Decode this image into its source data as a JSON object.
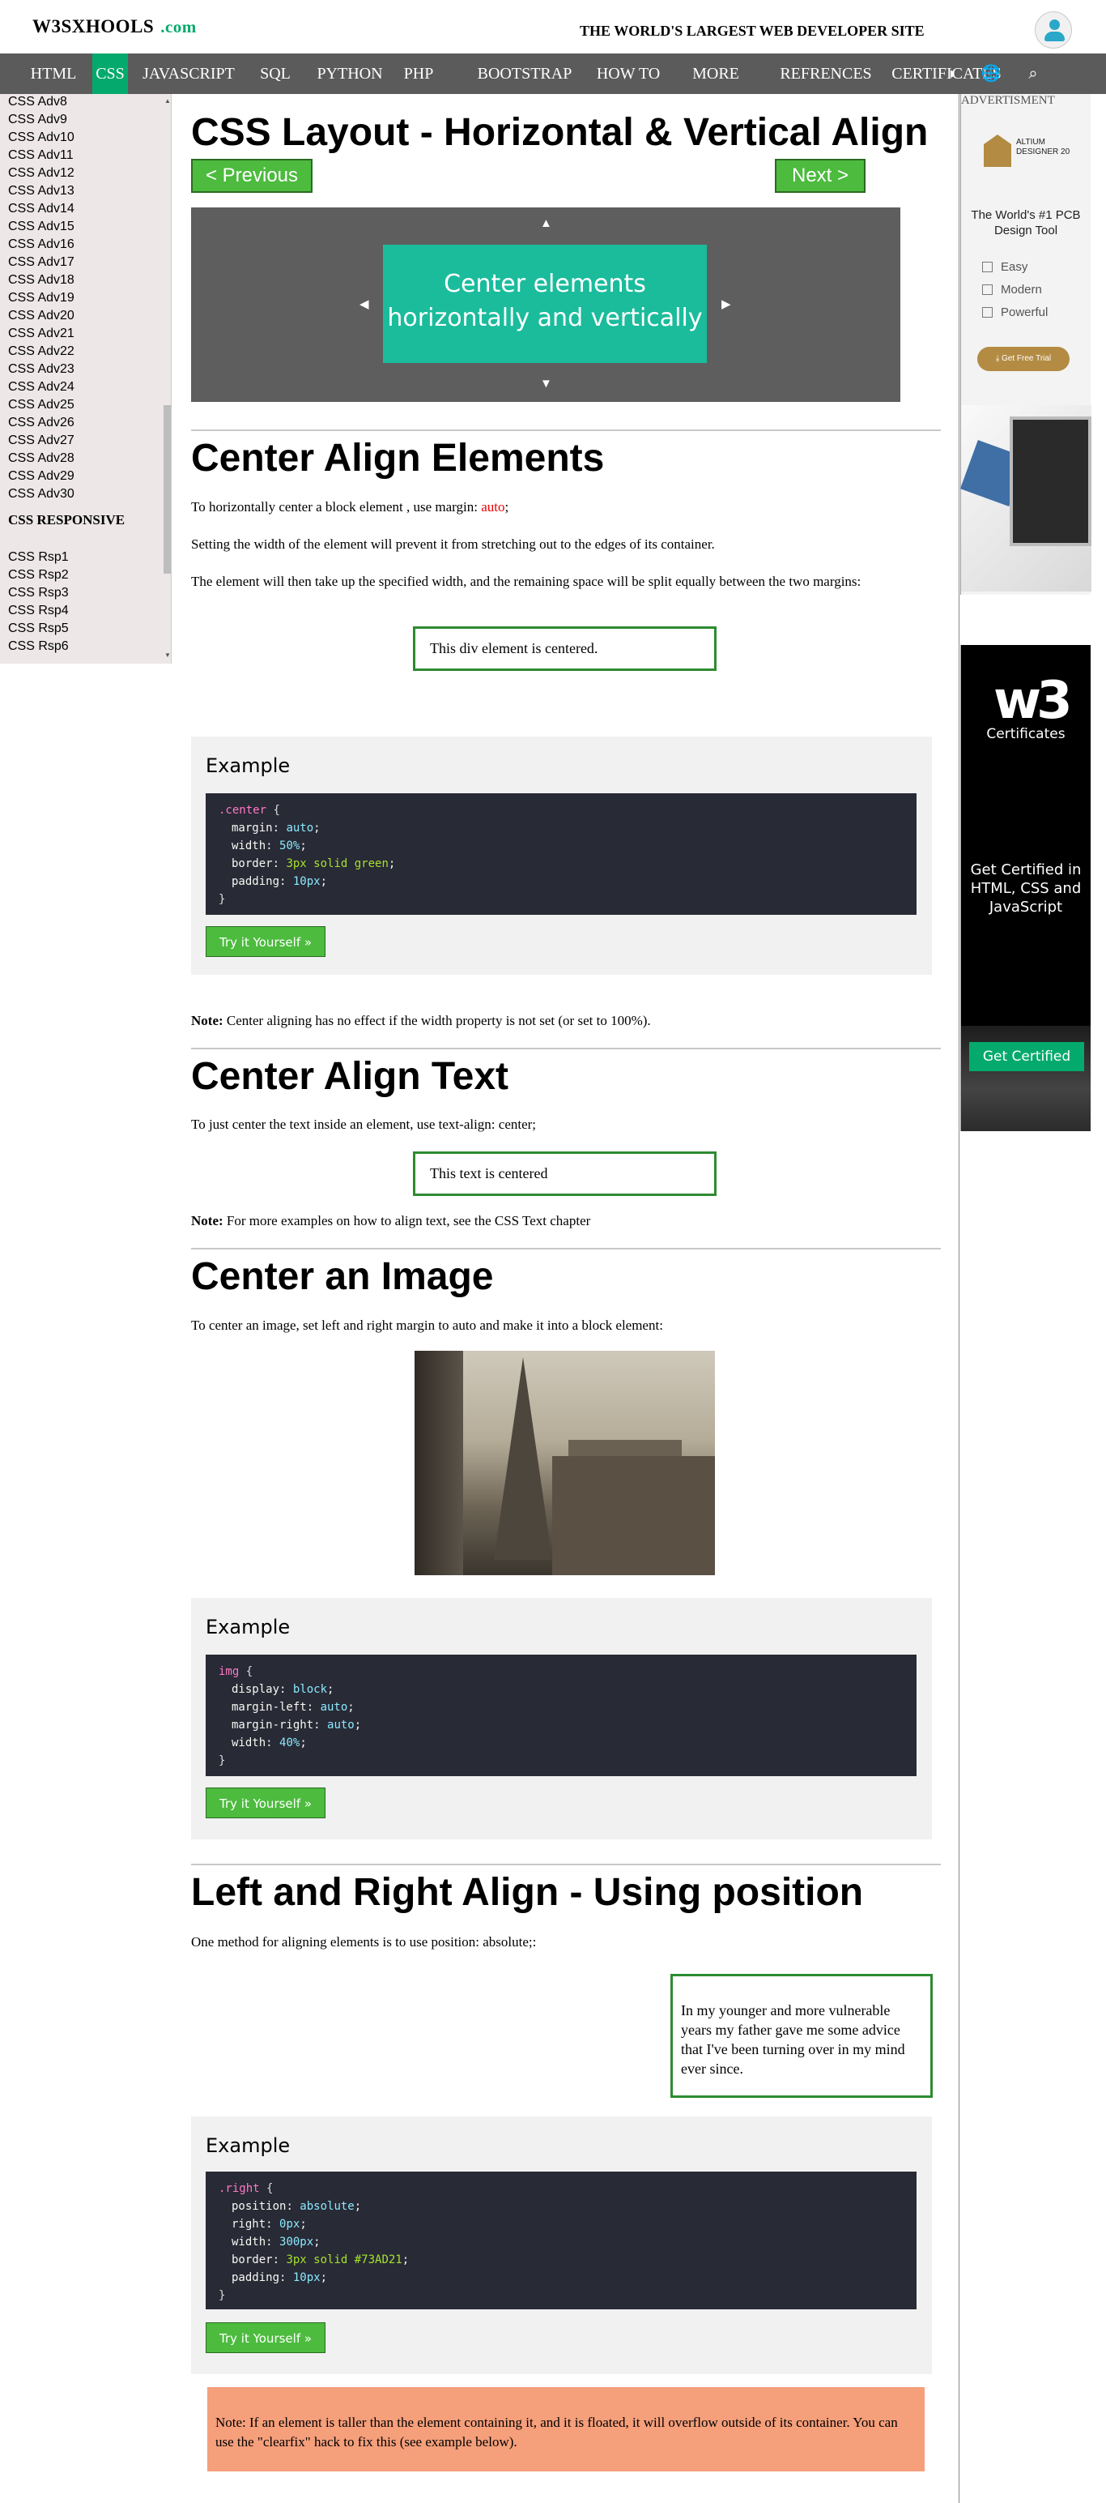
{
  "header": {
    "logo": "W3SXHOOLS",
    "logo_suffix": ".com",
    "tagline": "THE WORLD'S LARGEST WEB DEVELOPER SITE",
    "user_icon": "user-avatar-icon"
  },
  "nav": {
    "items": [
      "HTML",
      "CSS",
      "JAVASCRIPT",
      "SQL",
      "PYTHON",
      "PHP",
      "BOOTSTRAP",
      "HOW TO",
      "MORE",
      "REFRENCES",
      "CERTIFICATES"
    ],
    "active": "CSS",
    "icons": [
      "contrast-icon",
      "globe-icon",
      "search-icon"
    ],
    "bg": "#5b5b5b",
    "accent": "#04aa6d"
  },
  "sidebar": {
    "adv_items": [
      "CSS Adv8",
      "CSS Adv9",
      "CSS Adv10",
      "CSS Adv11",
      "CSS Adv12",
      "CSS Adv13",
      "CSS Adv14",
      "CSS Adv15",
      "CSS Adv16",
      "CSS Adv17",
      "CSS Adv18",
      "CSS Adv19",
      "CSS Adv20",
      "CSS Adv21",
      "CSS Adv22",
      "CSS Adv23",
      "CSS Adv24",
      "CSS Adv25",
      "CSS Adv26",
      "CSS Adv27",
      "CSS Adv28",
      "CSS Adv29",
      "CSS Adv30"
    ],
    "section_heading": "CSS RESPONSIVE",
    "rsp_items": [
      "CSS Rsp1",
      "CSS Rsp2",
      "CSS Rsp3",
      "CSS Rsp4",
      "CSS Rsp5",
      "CSS Rsp6"
    ]
  },
  "main": {
    "title": "CSS Layout - Horizontal & Vertical Align",
    "prev_label": "< Previous",
    "next_label": "Next >",
    "demo_text": "Center elements horizontally and vertically",
    "sections": {
      "center_elements": {
        "heading": "Center Align Elements",
        "p1_pre": "To horizontally center a block element , use margin: ",
        "p1_code": "auto",
        "p1_post": ";",
        "p2": "Setting the width of the element will prevent it from stretching out to the edges of its container.",
        "p3": "The element will then take up the specified width, and the remaining space will be split equally between the two margins:",
        "demo_box": "This div element is centered.",
        "example_title": "Example",
        "code_selector": ".center",
        "code_lines": [
          [
            "margin",
            "auto"
          ],
          [
            "width",
            "50%"
          ],
          [
            "border",
            "3px solid green"
          ],
          [
            "padding",
            "10px"
          ]
        ],
        "try_label": "Try it Yourself »",
        "note_bold": "Note:",
        "note": " Center aligning has no effect if the width property is not set (or set to 100%)."
      },
      "center_text": {
        "heading": "Center Align Text",
        "p1": "To just center the text inside an element, use text-align: center;",
        "demo_box": "This text is centered",
        "note_bold": "Note:",
        "note": " For more examples on how to align text, see the CSS Text chapter"
      },
      "center_image": {
        "heading": "Center an Image",
        "p1": "To center an image, set left and right margin to auto and make it into a block element:",
        "example_title": "Example",
        "code_selector": "img",
        "code_lines": [
          [
            "display",
            "block"
          ],
          [
            "margin-left",
            "auto"
          ],
          [
            "margin-right",
            "auto"
          ],
          [
            "width",
            "40%"
          ]
        ],
        "try_label": "Try it Yourself »"
      },
      "position": {
        "heading": "Left and Right Align - Using position",
        "p1": "One method for aligning elements is to use position: absolute;:",
        "demo_box": "In my younger and more vulnerable years my father gave me some advice that I've been turning over in my mind ever since.",
        "example_title": "Example",
        "code_selector": ".right",
        "code_lines": [
          [
            "position",
            "absolute"
          ],
          [
            "right",
            "0px"
          ],
          [
            "width",
            "300px"
          ],
          [
            "border",
            "3px solid #73AD21"
          ],
          [
            "padding",
            "10px"
          ]
        ],
        "try_label": "Try it Yourself »",
        "note": "Note: If an element is taller than the element containing it, and it is floated, it will overflow outside of its container. You can use the \"clearfix\" hack to fix this (see example below)."
      }
    }
  },
  "ads": {
    "label": "ADVERTISMENT",
    "ad1": {
      "brand_line1": "ALTIUM",
      "brand_line2": "DESIGNER 20",
      "headline": "The World's #1 PCB Design Tool",
      "features": [
        "Easy",
        "Modern",
        "Powerful"
      ],
      "cta": "⤓ Get Free Trial"
    },
    "ad2": {
      "logo": "w3",
      "subtitle": "Certificates",
      "text": "Get Certified in HTML, CSS and JavaScript",
      "cta": "Get Certified"
    }
  }
}
